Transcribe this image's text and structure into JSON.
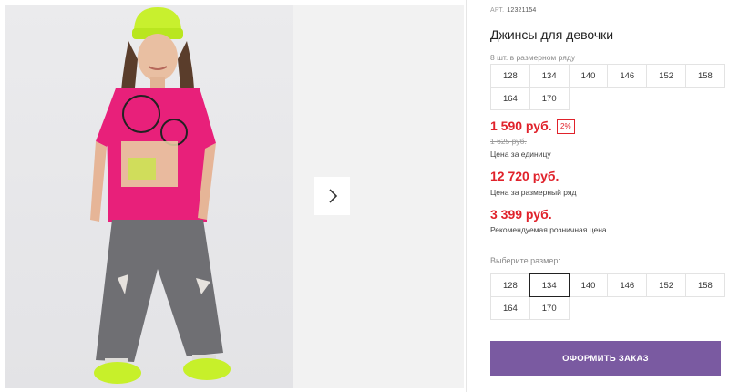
{
  "product": {
    "art_label": "АРТ.",
    "art_number": "12321154",
    "title": "Джинсы для девочки",
    "pack_note": "8 шт. в размерном ряду"
  },
  "pack_sizes": [
    "128",
    "134",
    "140",
    "146",
    "152",
    "158",
    "164",
    "170"
  ],
  "prices": {
    "unit_price": "1 590 руб.",
    "discount": "2%",
    "old_price": "1 625 руб.",
    "unit_label": "Цена за единицу",
    "pack_price": "12 720 руб.",
    "pack_label": "Цена за размерный ряд",
    "retail_price": "3 399 руб.",
    "retail_label": "Рекомендуемая розничная цена"
  },
  "size_picker": {
    "label": "Выберите размер:",
    "sizes": [
      "128",
      "134",
      "140",
      "146",
      "152",
      "158",
      "164",
      "170"
    ],
    "selected": "134"
  },
  "order_button": "ОФОРМИТЬ ЗАКАЗ",
  "colors": {
    "price_red": "#e0222b",
    "button_purple": "#7a5aa1",
    "shirt_pink": "#e8207a",
    "sneaker_neon": "#c7f02a"
  },
  "icons": {
    "next": "chevron-right-icon"
  }
}
